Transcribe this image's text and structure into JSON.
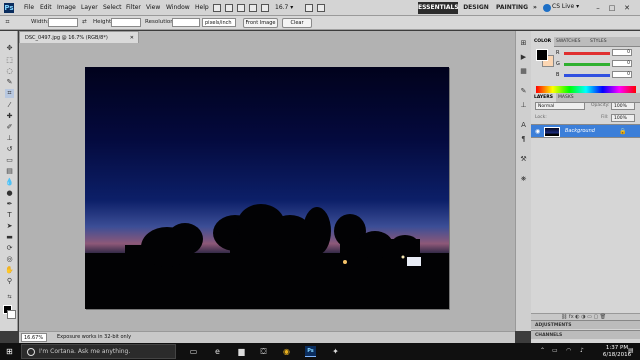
{
  "menubar": {
    "logo": "Ps",
    "items": [
      "File",
      "Edit",
      "Image",
      "Layer",
      "Select",
      "Filter",
      "View",
      "Window",
      "Help"
    ],
    "zoom": "16.7",
    "workspaces": [
      "ESSENTIALS",
      "DESIGN",
      "PAINTING",
      "»"
    ],
    "cs_live": "CS Live ▾",
    "win_controls": [
      "–",
      "□",
      "✕"
    ]
  },
  "options": {
    "width_label": "Width:",
    "height_label": "Height:",
    "resolution_label": "Resolution:",
    "resolution_unit": "pixels/inch",
    "front_image": "Front Image",
    "clear": "Clear"
  },
  "document": {
    "tab_title": "DSC_0497.jpg @ 16.7% (RGB/8*)",
    "close": "✕"
  },
  "status": {
    "zoom": "16.67%",
    "info": "Exposure works in 32-bit only"
  },
  "color_panel": {
    "tabs": [
      "COLOR",
      "SWATCHES",
      "STYLES"
    ],
    "channels": [
      {
        "label": "R",
        "value": "0",
        "color": "#e03030"
      },
      {
        "label": "G",
        "value": "0",
        "color": "#30b030"
      },
      {
        "label": "B",
        "value": "0",
        "color": "#3050e0"
      }
    ]
  },
  "layers_panel": {
    "tabs": [
      "LAYERS",
      "MASKS"
    ],
    "blend_mode": "Normal",
    "opacity_label": "Opacity:",
    "opacity": "100%",
    "lock_label": "Lock:",
    "fill_label": "Fill:",
    "fill": "100%",
    "layer_name": "Background",
    "lock_icon": "🔒"
  },
  "collapsed_panels": [
    "ADJUSTMENTS",
    "CHANNELS"
  ],
  "taskbar": {
    "search_placeholder": "I'm Cortana. Ask me anything.",
    "ps_label": "Ps",
    "time": "1:37 PM",
    "date": "6/18/2016"
  }
}
